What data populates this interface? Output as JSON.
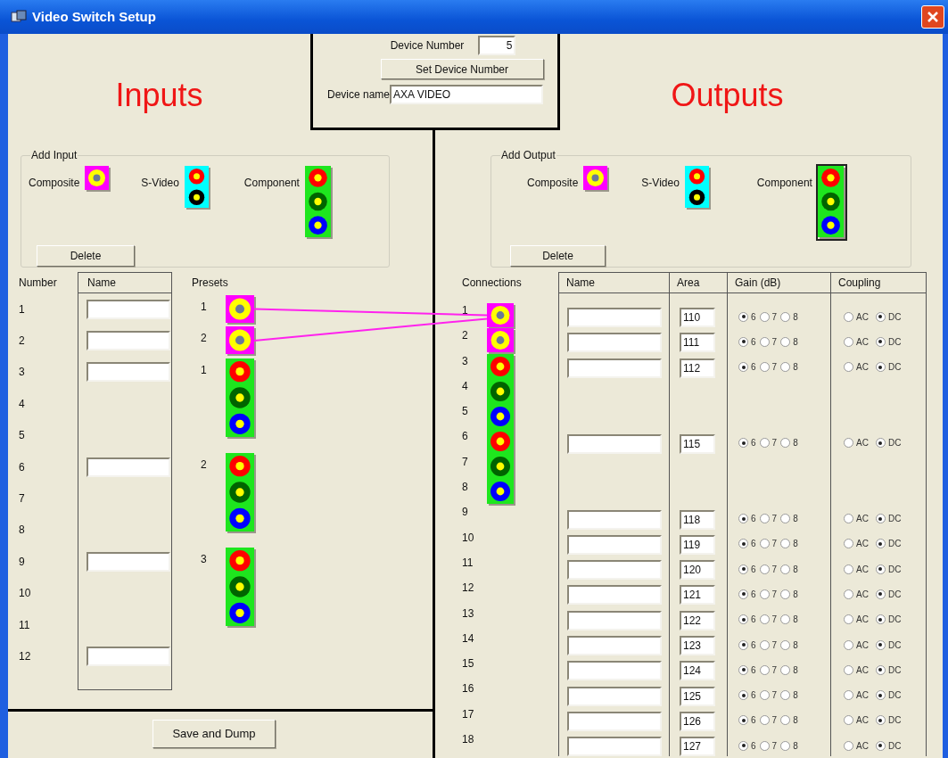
{
  "window": {
    "title": "Video Switch Setup"
  },
  "device": {
    "number_label": "Device Number",
    "number": "5",
    "set_button": "Set Device Number",
    "name_label": "Device name",
    "name": "AXA VIDEO"
  },
  "inputs": {
    "heading": "Inputs",
    "add_group": {
      "legend": "Add Input",
      "types": [
        {
          "kind": "composite",
          "label": "Composite",
          "selected": false
        },
        {
          "kind": "svideo",
          "label": "S-Video",
          "selected": false
        },
        {
          "kind": "component",
          "label": "Component",
          "selected": false
        }
      ],
      "delete_button": "Delete"
    },
    "columns": [
      "Number",
      "Name",
      "Presets"
    ],
    "rows": [
      {
        "number": "1",
        "name_field": true,
        "preset": {
          "kind": "composite",
          "label": "1",
          "linked": true
        }
      },
      {
        "number": "2",
        "name_field": true,
        "preset": {
          "kind": "composite",
          "label": "2",
          "linked": true
        }
      },
      {
        "number": "3",
        "name_field": true,
        "preset": {
          "kind": "component",
          "label": "1"
        }
      },
      {
        "number": "4",
        "name_field": false
      },
      {
        "number": "5",
        "name_field": false
      },
      {
        "number": "6",
        "name_field": true,
        "preset": {
          "kind": "component",
          "label": "2"
        }
      },
      {
        "number": "7",
        "name_field": false
      },
      {
        "number": "8",
        "name_field": false
      },
      {
        "number": "9",
        "name_field": true,
        "preset": {
          "kind": "component",
          "label": "3"
        }
      },
      {
        "number": "10",
        "name_field": false
      },
      {
        "number": "11",
        "name_field": false
      },
      {
        "number": "12",
        "name_field": true
      }
    ],
    "save_button": "Save and Dump"
  },
  "outputs": {
    "heading": "Outputs",
    "add_group": {
      "legend": "Add Output",
      "types": [
        {
          "kind": "composite",
          "label": "Composite",
          "selected": false
        },
        {
          "kind": "svideo",
          "label": "S-Video",
          "selected": false
        },
        {
          "kind": "component",
          "label": "Component",
          "selected": true
        }
      ],
      "delete_button": "Delete"
    },
    "columns": [
      "Connections",
      "Name",
      "Area",
      "Gain (dB)",
      "Coupling"
    ],
    "rows": [
      {
        "number": "1",
        "connector": {
          "kind": "composite",
          "linked": true
        },
        "area": "110",
        "gain": [
          {
            "label": "6",
            "selected": true
          },
          {
            "label": "7",
            "selected": false
          },
          {
            "label": "8",
            "selected": false
          }
        ],
        "coupling": [
          {
            "label": "AC",
            "selected": false
          },
          {
            "label": "DC",
            "selected": true
          }
        ]
      },
      {
        "number": "2",
        "connector": {
          "kind": "composite"
        },
        "area": "111",
        "gain": [
          {
            "label": "6",
            "selected": true
          },
          {
            "label": "7",
            "selected": false
          },
          {
            "label": "8",
            "selected": false
          }
        ],
        "coupling": [
          {
            "label": "AC",
            "selected": false
          },
          {
            "label": "DC",
            "selected": true
          }
        ]
      },
      {
        "number": "3",
        "connector": {
          "kind": "component"
        },
        "area": "112",
        "gain": [
          {
            "label": "6",
            "selected": true
          },
          {
            "label": "7",
            "selected": false
          },
          {
            "label": "8",
            "selected": false
          }
        ],
        "coupling": [
          {
            "label": "AC",
            "selected": false
          },
          {
            "label": "DC",
            "selected": true
          }
        ]
      },
      {
        "number": "4"
      },
      {
        "number": "5"
      },
      {
        "number": "6",
        "connector": {
          "kind": "component"
        },
        "area": "115",
        "gain": [
          {
            "label": "6",
            "selected": true
          },
          {
            "label": "7",
            "selected": false
          },
          {
            "label": "8",
            "selected": false
          }
        ],
        "coupling": [
          {
            "label": "AC",
            "selected": false
          },
          {
            "label": "DC",
            "selected": true
          }
        ]
      },
      {
        "number": "7"
      },
      {
        "number": "8"
      },
      {
        "number": "9",
        "area": "118",
        "gain": [
          {
            "label": "6",
            "selected": true
          },
          {
            "label": "7",
            "selected": false
          },
          {
            "label": "8",
            "selected": false
          }
        ],
        "coupling": [
          {
            "label": "AC",
            "selected": false
          },
          {
            "label": "DC",
            "selected": true
          }
        ]
      },
      {
        "number": "10",
        "area": "119",
        "gain": [
          {
            "label": "6",
            "selected": true
          },
          {
            "label": "7",
            "selected": false
          },
          {
            "label": "8",
            "selected": false
          }
        ],
        "coupling": [
          {
            "label": "AC",
            "selected": false
          },
          {
            "label": "DC",
            "selected": true
          }
        ]
      },
      {
        "number": "11",
        "area": "120",
        "gain": [
          {
            "label": "6",
            "selected": true
          },
          {
            "label": "7",
            "selected": false
          },
          {
            "label": "8",
            "selected": false
          }
        ],
        "coupling": [
          {
            "label": "AC",
            "selected": false
          },
          {
            "label": "DC",
            "selected": true
          }
        ]
      },
      {
        "number": "12",
        "area": "121",
        "gain": [
          {
            "label": "6",
            "selected": true
          },
          {
            "label": "7",
            "selected": false
          },
          {
            "label": "8",
            "selected": false
          }
        ],
        "coupling": [
          {
            "label": "AC",
            "selected": false
          },
          {
            "label": "DC",
            "selected": true
          }
        ]
      },
      {
        "number": "13",
        "area": "122",
        "gain": [
          {
            "label": "6",
            "selected": true
          },
          {
            "label": "7",
            "selected": false
          },
          {
            "label": "8",
            "selected": false
          }
        ],
        "coupling": [
          {
            "label": "AC",
            "selected": false
          },
          {
            "label": "DC",
            "selected": true
          }
        ]
      },
      {
        "number": "14",
        "area": "123",
        "gain": [
          {
            "label": "6",
            "selected": true
          },
          {
            "label": "7",
            "selected": false
          },
          {
            "label": "8",
            "selected": false
          }
        ],
        "coupling": [
          {
            "label": "AC",
            "selected": false
          },
          {
            "label": "DC",
            "selected": true
          }
        ]
      },
      {
        "number": "15",
        "area": "124",
        "gain": [
          {
            "label": "6",
            "selected": true
          },
          {
            "label": "7",
            "selected": false
          },
          {
            "label": "8",
            "selected": false
          }
        ],
        "coupling": [
          {
            "label": "AC",
            "selected": false
          },
          {
            "label": "DC",
            "selected": true
          }
        ]
      },
      {
        "number": "16",
        "area": "125",
        "gain": [
          {
            "label": "6",
            "selected": true
          },
          {
            "label": "7",
            "selected": false
          },
          {
            "label": "8",
            "selected": false
          }
        ],
        "coupling": [
          {
            "label": "AC",
            "selected": false
          },
          {
            "label": "DC",
            "selected": true
          }
        ]
      },
      {
        "number": "17",
        "area": "126",
        "gain": [
          {
            "label": "6",
            "selected": true
          },
          {
            "label": "7",
            "selected": false
          },
          {
            "label": "8",
            "selected": false
          }
        ],
        "coupling": [
          {
            "label": "AC",
            "selected": false
          },
          {
            "label": "DC",
            "selected": true
          }
        ]
      },
      {
        "number": "18",
        "area": "127",
        "gain": [
          {
            "label": "6",
            "selected": true
          },
          {
            "label": "7",
            "selected": false
          },
          {
            "label": "8",
            "selected": false
          }
        ],
        "coupling": [
          {
            "label": "AC",
            "selected": false
          },
          {
            "label": "DC",
            "selected": true
          }
        ]
      }
    ]
  }
}
